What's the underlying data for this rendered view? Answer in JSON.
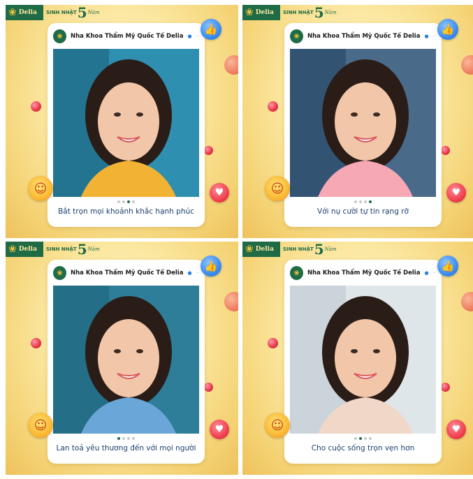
{
  "brand": {
    "name": "Delia",
    "anniversary_small": "SINH NHẬT",
    "anniversary_number": "5",
    "anniversary_script": "Năm"
  },
  "posts": [
    {
      "page_name": "Nha Khoa Thẩm Mỹ Quốc Tế Delia",
      "caption": "Bắt trọn mọi khoảnh khắc hạnh phúc",
      "slide_index": 2,
      "slide_count": 4
    },
    {
      "page_name": "Nha Khoa Thẩm Mỹ Quốc Tế Delia",
      "caption": "Với nụ cười tự tin rạng rỡ",
      "slide_index": 3,
      "slide_count": 4
    },
    {
      "page_name": "Nha Khoa Thẩm Mỹ Quốc Tế Delia",
      "caption": "Lan toả yêu thương đến với mọi người",
      "slide_index": 0,
      "slide_count": 4
    },
    {
      "page_name": "Nha Khoa Thẩm Mỹ Quốc Tế Delia",
      "caption": "Cho cuộc sống trọn vẹn hơn",
      "slide_index": 1,
      "slide_count": 4
    }
  ],
  "icons": {
    "like": "thumbs-up-icon",
    "love": "heart-icon",
    "wow": "wow-emoji-icon",
    "verified": "verified-badge-icon",
    "more": "more-icon"
  },
  "colors": {
    "brand_green": "#1f6b46",
    "gold_background": "#f4d273",
    "caption_text": "#1c3f6e",
    "like_blue": "#3b8cf0",
    "heart_red": "#ef3b4c"
  }
}
